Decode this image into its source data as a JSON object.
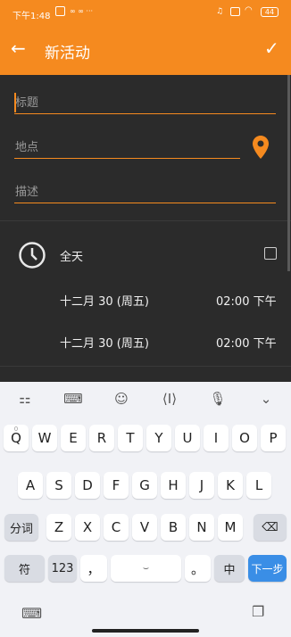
{
  "status": {
    "time": "下午1:48",
    "battery": "44"
  },
  "appbar": {
    "title": "新活动"
  },
  "form": {
    "title_placeholder": "标题",
    "location_placeholder": "地点",
    "description_placeholder": "描述",
    "allday_label": "全天",
    "start_date": "十二月 30 (周五)",
    "start_time": "02:00 下午",
    "end_date": "十二月 30 (周五)",
    "end_time": "02:00 下午"
  },
  "keyboard": {
    "row1": [
      "Q",
      "W",
      "E",
      "R",
      "T",
      "Y",
      "U",
      "I",
      "O",
      "P"
    ],
    "row1_alt": [
      "1",
      "2",
      "3",
      "4",
      "5",
      "6",
      "7",
      "8",
      "9",
      "0"
    ],
    "row2": [
      "A",
      "S",
      "D",
      "F",
      "G",
      "H",
      "J",
      "K",
      "L"
    ],
    "row3": [
      "Z",
      "X",
      "C",
      "V",
      "B",
      "N",
      "M"
    ],
    "fenci": "分词",
    "fu": "符",
    "num": "123",
    "comma": "，",
    "period": "。",
    "zh": "中",
    "next": "下一步"
  },
  "colors": {
    "accent": "#f58a1f",
    "next_key": "#3a8ee6"
  }
}
